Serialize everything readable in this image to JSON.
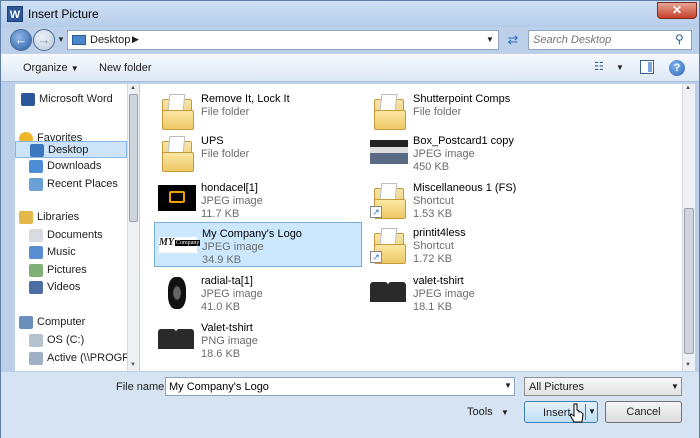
{
  "window": {
    "title": "Insert Picture",
    "app_icon": "W"
  },
  "address": {
    "location": "Desktop",
    "search_placeholder": "Search Desktop"
  },
  "toolbar": {
    "organize": "Organize",
    "new_folder": "New folder"
  },
  "nav": [
    {
      "label": "Microsoft Word",
      "icon": "word-icon"
    },
    {
      "label": "Favorites",
      "icon": "star-icon"
    },
    {
      "label": "Desktop",
      "icon": "desktop-icon",
      "selected": true
    },
    {
      "label": "Downloads",
      "icon": "downloads-icon"
    },
    {
      "label": "Recent Places",
      "icon": "recent-places-icon"
    },
    {
      "label": "Libraries",
      "icon": "libraries-icon"
    },
    {
      "label": "Documents",
      "icon": "documents-icon"
    },
    {
      "label": "Music",
      "icon": "music-icon"
    },
    {
      "label": "Pictures",
      "icon": "pictures-icon"
    },
    {
      "label": "Videos",
      "icon": "videos-icon"
    },
    {
      "label": "Computer",
      "icon": "computer-icon"
    },
    {
      "label": "OS (C:)",
      "icon": "drive-icon"
    },
    {
      "label": "Active (\\\\PROGR",
      "icon": "network-drive-icon"
    }
  ],
  "files": [
    {
      "name": "Remove It, Lock It",
      "type": "File folder",
      "size": "",
      "icon": "folder-icon"
    },
    {
      "name": "Shutterpoint Comps",
      "type": "File folder",
      "size": "",
      "icon": "folder-icon"
    },
    {
      "name": "UPS",
      "type": "File folder",
      "size": "",
      "icon": "folder-icon"
    },
    {
      "name": "Box_Postcard1 copy",
      "type": "JPEG image",
      "size": "450 KB",
      "icon": "postcard-thumbnail"
    },
    {
      "name": "hondacel[1]",
      "type": "JPEG image",
      "size": "11.7 KB",
      "icon": "engine-light-thumbnail"
    },
    {
      "name": "Miscellaneous 1 (FS)",
      "type": "Shortcut",
      "size": "1.53 KB",
      "icon": "folder-shortcut-icon"
    },
    {
      "name": "My Company's Logo",
      "type": "JPEG image",
      "size": "34.9 KB",
      "icon": "logo-thumbnail",
      "selected": true
    },
    {
      "name": "printit4less",
      "type": "Shortcut",
      "size": "1.72 KB",
      "icon": "folder-shortcut-icon"
    },
    {
      "name": "radial-ta[1]",
      "type": "JPEG image",
      "size": "41.0 KB",
      "icon": "tire-thumbnail"
    },
    {
      "name": "valet-tshirt",
      "type": "JPEG image",
      "size": "18.1 KB",
      "icon": "tshirt-thumbnail"
    },
    {
      "name": "Valet-tshirt",
      "type": "PNG image",
      "size": "18.6 KB",
      "icon": "tshirt-thumbnail"
    }
  ],
  "logo_thumb_text": {
    "my": "MY",
    "company": "Company"
  },
  "bottom": {
    "file_name_label": "File name:",
    "file_name_value": "My Company's Logo",
    "file_type": "All Pictures",
    "tools": "Tools",
    "insert": "Insert",
    "cancel": "Cancel"
  },
  "glyphs": {
    "close": "✕",
    "back": "←",
    "forward": "→",
    "refresh": "⇄",
    "search": "⚲",
    "help": "?",
    "dropdown": "▼",
    "chevron": "▶"
  }
}
